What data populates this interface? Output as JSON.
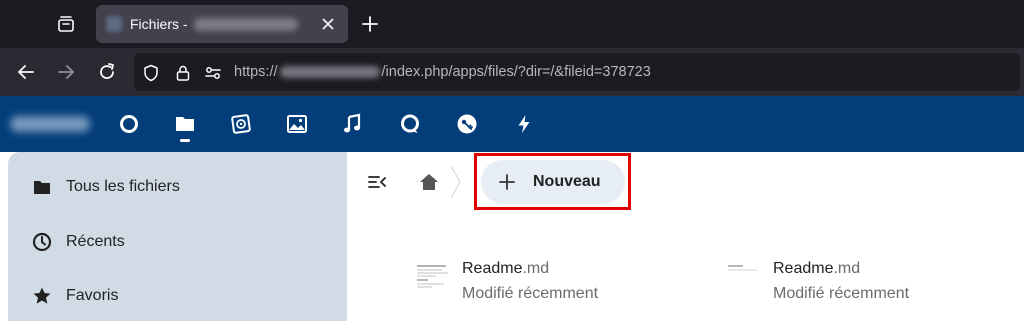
{
  "browser": {
    "tab": {
      "title": "Fichiers - "
    },
    "url": {
      "scheme": "https://",
      "path": "/index.php/apps/files/?dir=/&fileid=378723"
    }
  },
  "sidebar": {
    "items": [
      {
        "label": "Tous les fichiers",
        "icon": "folder-icon"
      },
      {
        "label": "Récents",
        "icon": "clock-icon"
      },
      {
        "label": "Favoris",
        "icon": "star-icon"
      }
    ]
  },
  "toolbar": {
    "new_label": "Nouveau"
  },
  "files": [
    {
      "name": "Readme",
      "ext": ".md",
      "meta": "Modifié récemment"
    },
    {
      "name": "Readme",
      "ext": ".md",
      "meta": "Modifié récemment"
    }
  ],
  "colors": {
    "header": "#033d7a",
    "sidebar": "#d0dbe6",
    "highlight": "#e00000",
    "browser_tabstrip": "#1c1b22",
    "browser_navbar": "#2b2a33"
  }
}
